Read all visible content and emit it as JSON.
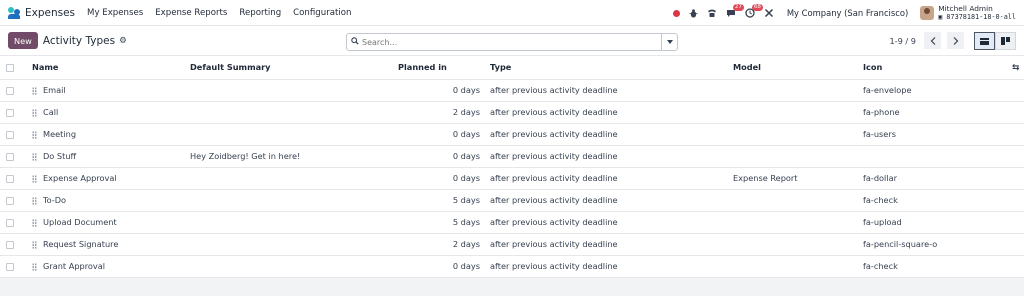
{
  "navbar": {
    "app_name": "Expenses",
    "menu": [
      "My Expenses",
      "Expense Reports",
      "Reporting",
      "Configuration"
    ],
    "messages_badge": "27",
    "activities_badge": "68",
    "company": "My Company (San Francisco)",
    "user_name": "Mitchell Admin",
    "db_name": "87378181-18-0-all"
  },
  "control": {
    "new_label": "New",
    "title": "Activity Types",
    "search_placeholder": "Search...",
    "pager_value": "1-9 / 9"
  },
  "columns": {
    "name": "Name",
    "summary": "Default Summary",
    "planned": "Planned in",
    "type": "Type",
    "model": "Model",
    "icon": "Icon"
  },
  "rows": [
    {
      "name": "Email",
      "summary": "",
      "planned": "0 days",
      "type": "after previous activity deadline",
      "model": "",
      "icon": "fa-envelope"
    },
    {
      "name": "Call",
      "summary": "",
      "planned": "2 days",
      "type": "after previous activity deadline",
      "model": "",
      "icon": "fa-phone"
    },
    {
      "name": "Meeting",
      "summary": "",
      "planned": "0 days",
      "type": "after previous activity deadline",
      "model": "",
      "icon": "fa-users"
    },
    {
      "name": "Do Stuff",
      "summary": "Hey Zoidberg! Get in here!",
      "planned": "0 days",
      "type": "after previous activity deadline",
      "model": "",
      "icon": ""
    },
    {
      "name": "Expense Approval",
      "summary": "",
      "planned": "0 days",
      "type": "after previous activity deadline",
      "model": "Expense Report",
      "icon": "fa-dollar"
    },
    {
      "name": "To-Do",
      "summary": "",
      "planned": "5 days",
      "type": "after previous activity deadline",
      "model": "",
      "icon": "fa-check"
    },
    {
      "name": "Upload Document",
      "summary": "",
      "planned": "5 days",
      "type": "after previous activity deadline",
      "model": "",
      "icon": "fa-upload"
    },
    {
      "name": "Request Signature",
      "summary": "",
      "planned": "2 days",
      "type": "after previous activity deadline",
      "model": "",
      "icon": "fa-pencil-square-o"
    },
    {
      "name": "Grant Approval",
      "summary": "",
      "planned": "0 days",
      "type": "after previous activity deadline",
      "model": "",
      "icon": "fa-check"
    }
  ]
}
